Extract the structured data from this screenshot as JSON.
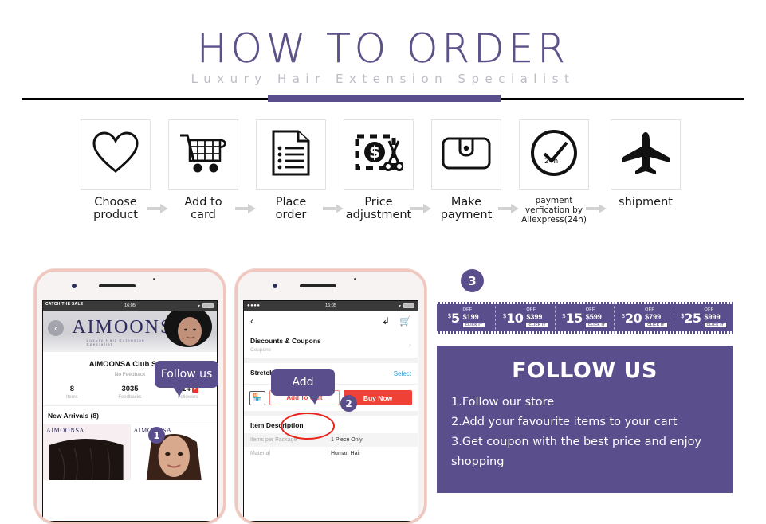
{
  "header": {
    "title": "HOW TO ORDER",
    "subtitle": "Luxury Hair Extension Specialist"
  },
  "steps": [
    {
      "icon": "heart-icon",
      "label_line1": "Choose",
      "label_line2": "product"
    },
    {
      "icon": "shopping-cart-icon",
      "label_line1": "Add to",
      "label_line2": "card"
    },
    {
      "icon": "document-icon",
      "label_line1": "Place",
      "label_line2": "order"
    },
    {
      "icon": "price-scissors-icon",
      "label_line1": "Price",
      "label_line2": "adjustment"
    },
    {
      "icon": "wallet-icon",
      "label_line1": "Make",
      "label_line2": "payment"
    },
    {
      "icon": "clock-check-icon",
      "label_line1": "payment",
      "label_line2": "verfication by",
      "label_line3": "Aliexpress(24h)"
    },
    {
      "icon": "airplane-icon",
      "label_line1": "shipment",
      "label_line2": ""
    }
  ],
  "phone_left": {
    "status_bar": {
      "carrier": "CATCH THE SALE",
      "time": "16:05"
    },
    "store_banner": {
      "brand": "AIMOONSA",
      "tagline": "Luxury Hair Extension Specialist"
    },
    "store_name": "AIMOONSA Club Store",
    "feedback": "No Feedback",
    "stats": [
      {
        "num": "8",
        "label": "Items"
      },
      {
        "num": "3035",
        "label": "Feedbacks"
      },
      {
        "num": "714",
        "label": "Followers",
        "badge": "+"
      }
    ],
    "new_arrivals": "New Arrivals (8)",
    "products": [
      {
        "brand": "AIMOONSA"
      },
      {
        "brand": "AIMOONSA"
      }
    ],
    "callout": "Follow us",
    "badge": "1"
  },
  "phone_right": {
    "status_bar": {
      "carrier": "",
      "time": "16:05"
    },
    "coupons_row": {
      "title": "Discounts & Coupons",
      "sub": "Coupons"
    },
    "length_row": {
      "title": "Stretched Length",
      "select": "Select"
    },
    "buttons": {
      "add_to_cart": "Add To Cart",
      "buy_now": "Buy Now"
    },
    "description_title": "Item Description",
    "description_rows": [
      {
        "key": "Items per Package",
        "value": "1 Piece Only"
      },
      {
        "key": "Material",
        "value": "Human Hair"
      }
    ],
    "callout": "Add",
    "badge": "2"
  },
  "right_panel": {
    "badge": "3",
    "coupons": [
      {
        "amount": "5",
        "currency": "$",
        "off": "OFF",
        "min": "$199",
        "click": "CLICK IT"
      },
      {
        "amount": "10",
        "currency": "$",
        "off": "OFF",
        "min": "$399",
        "click": "CLICK IT"
      },
      {
        "amount": "15",
        "currency": "$",
        "off": "OFF",
        "min": "$599",
        "click": "CLICK IT"
      },
      {
        "amount": "20",
        "currency": "$",
        "off": "OFF",
        "min": "$799",
        "click": "CLICK IT"
      },
      {
        "amount": "25",
        "currency": "$",
        "off": "OFF",
        "min": "$999",
        "click": "CLICK IT"
      }
    ],
    "follow": {
      "title": "FOLLOW US",
      "lines": [
        "1.Follow our store",
        "2.Add your favourite items to your cart",
        "3.Get coupon with the best price and enjoy",
        "shopping"
      ]
    }
  },
  "colors": {
    "purple": "#5b4e8c",
    "title_purple": "#5d5188",
    "subtitle_gray": "#bdbdc6",
    "red": "#ef4136",
    "phone_frame": "#f0c6bd"
  }
}
